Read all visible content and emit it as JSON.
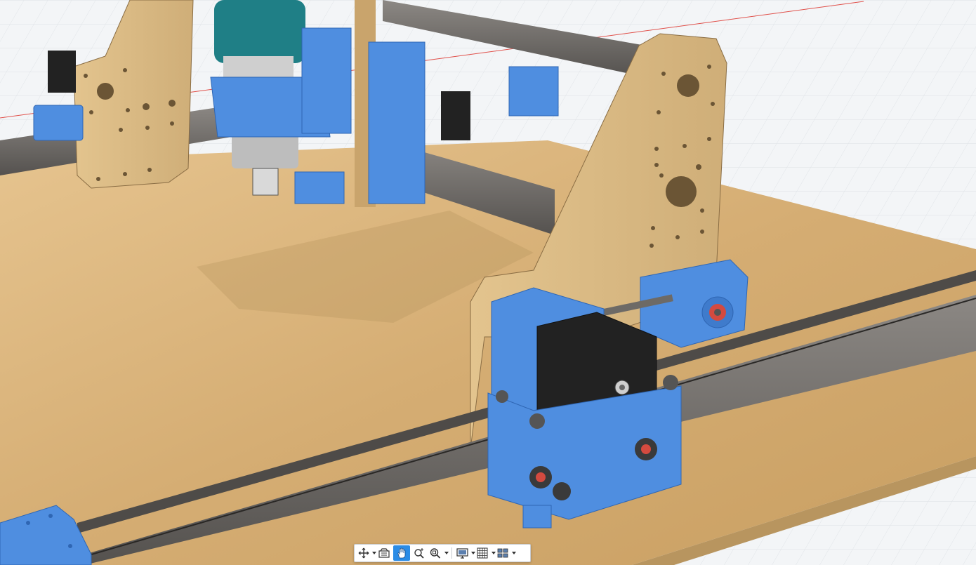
{
  "app": {
    "name": "CAD 3D viewport"
  },
  "scene": {
    "description_none": "",
    "colors": {
      "grid_bg": "#f3f5f7",
      "grid_line": "#dfe3e7",
      "axis_x": "#e0504a",
      "axis_y": "#6a7bd8",
      "wood": "#d9b683",
      "wood_dark": "#b8955f",
      "blue_part": "#4f8ee0",
      "blue_dark": "#2f66b3",
      "rail": "#6e6a66",
      "motor": "#222222"
    }
  },
  "toolbar": {
    "buttons": [
      {
        "id": "orbit",
        "icon": "orbit-icon",
        "has_menu": true,
        "active": false
      },
      {
        "id": "look-at",
        "icon": "look-at-icon",
        "has_menu": false,
        "active": false
      },
      {
        "id": "pan",
        "icon": "pan-hand-icon",
        "has_menu": false,
        "active": true
      },
      {
        "id": "zoom",
        "icon": "zoom-icon",
        "has_menu": false,
        "active": false
      },
      {
        "id": "fit",
        "icon": "zoom-window-icon",
        "has_menu": true,
        "active": false
      },
      {
        "id": "display-settings",
        "icon": "display-settings-icon",
        "has_menu": true,
        "active": false
      },
      {
        "id": "grid-snaps",
        "icon": "grid-icon",
        "has_menu": true,
        "active": false
      },
      {
        "id": "viewports",
        "icon": "viewports-icon",
        "has_menu": true,
        "active": false
      }
    ]
  }
}
